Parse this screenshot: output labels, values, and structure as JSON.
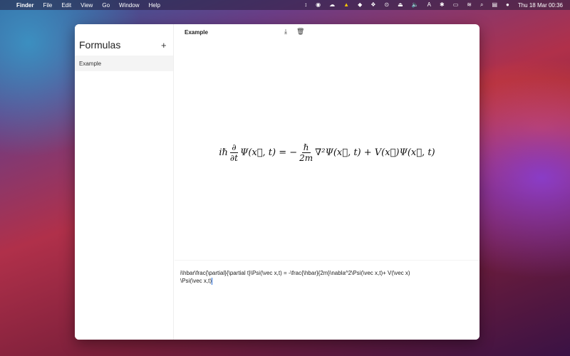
{
  "menubar": {
    "apple": "",
    "app": "Finder",
    "items": [
      "File",
      "Edit",
      "View",
      "Go",
      "Window",
      "Help"
    ],
    "clock": "Thu 18 Mar  00:36",
    "status_icons": [
      "↕",
      "◉",
      "☁",
      "▲",
      "◆",
      "❖",
      "⊙",
      "⏏",
      "🔈",
      "A",
      "✱",
      "▭",
      "≋",
      "⌕",
      "▤",
      "●"
    ]
  },
  "sidebar": {
    "title": "Formulas",
    "add": "+",
    "items": [
      {
        "label": "Example"
      }
    ]
  },
  "main": {
    "title": "Example",
    "download": "⤓",
    "trash": "🗑"
  },
  "render": {
    "lhs_prefix": "iℏ",
    "d_num": "∂",
    "d_den": "∂t",
    "psi1": "Ψ(x⃗, t) = −",
    "h_num": "ℏ",
    "h_den": "2m",
    "rest": "∇²Ψ(x⃗, t) + V(x⃗)Ψ(x⃗, t)"
  },
  "editor": {
    "value": "i\\hbar\\frac{\\partial}{\\partial t}\\Psi(\\vec x,t) = -\\frac{\\hbar}{2m}\\nabla^2\\Psi(\\vec x,t)+ V(\\vec x)\n\\Psi(\\vec x,t)"
  }
}
